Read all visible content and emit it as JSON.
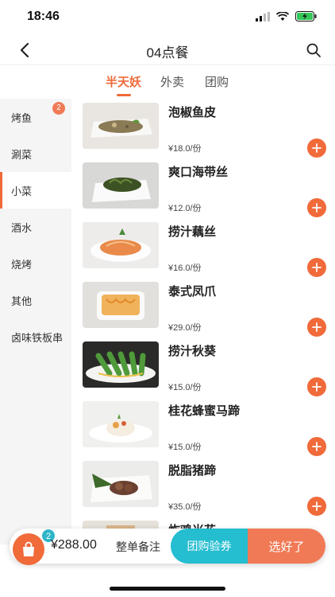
{
  "status_bar": {
    "time": "18:46"
  },
  "nav": {
    "title": "04点餐"
  },
  "tabs": [
    {
      "label": "半天妖",
      "active": true
    },
    {
      "label": "外卖",
      "active": false
    },
    {
      "label": "团购",
      "active": false
    }
  ],
  "sidebar": {
    "items": [
      {
        "label": "烤鱼",
        "badge": "2"
      },
      {
        "label": "涮菜"
      },
      {
        "label": "小菜",
        "active": true
      },
      {
        "label": "酒水"
      },
      {
        "label": "烧烤"
      },
      {
        "label": "其他"
      },
      {
        "label": "卤味铁板串"
      }
    ]
  },
  "dishes": [
    {
      "name": "泡椒鱼皮",
      "price": "¥18.0/份",
      "image": "pickled-pepper-fish-skin"
    },
    {
      "name": "爽口海带丝",
      "price": "¥12.0/份",
      "image": "kelp-shreds"
    },
    {
      "name": "捞汁藕丝",
      "price": "¥16.0/份",
      "image": "lotus-root-shreds"
    },
    {
      "name": "泰式凤爪",
      "price": "¥29.0/份",
      "image": "thai-chicken-feet"
    },
    {
      "name": "捞汁秋葵",
      "price": "¥15.0/份",
      "image": "okra"
    },
    {
      "name": "桂花蜂蜜马蹄",
      "price": "¥15.0/份",
      "image": "water-chestnut"
    },
    {
      "name": "脱脂猪蹄",
      "price": "¥35.0/份",
      "image": "pork-trotters"
    },
    {
      "name": "炸鸡米花",
      "price": "",
      "image": "popcorn-chicken"
    }
  ],
  "cart": {
    "count": "2",
    "total": "¥288.00",
    "note_label": "整单备注",
    "voucher_label": "团购验券",
    "done_label": "选好了"
  },
  "colors": {
    "accent": "#f06a3a",
    "teal": "#25bdd0",
    "sidebar_bg": "#f5f5f5"
  }
}
